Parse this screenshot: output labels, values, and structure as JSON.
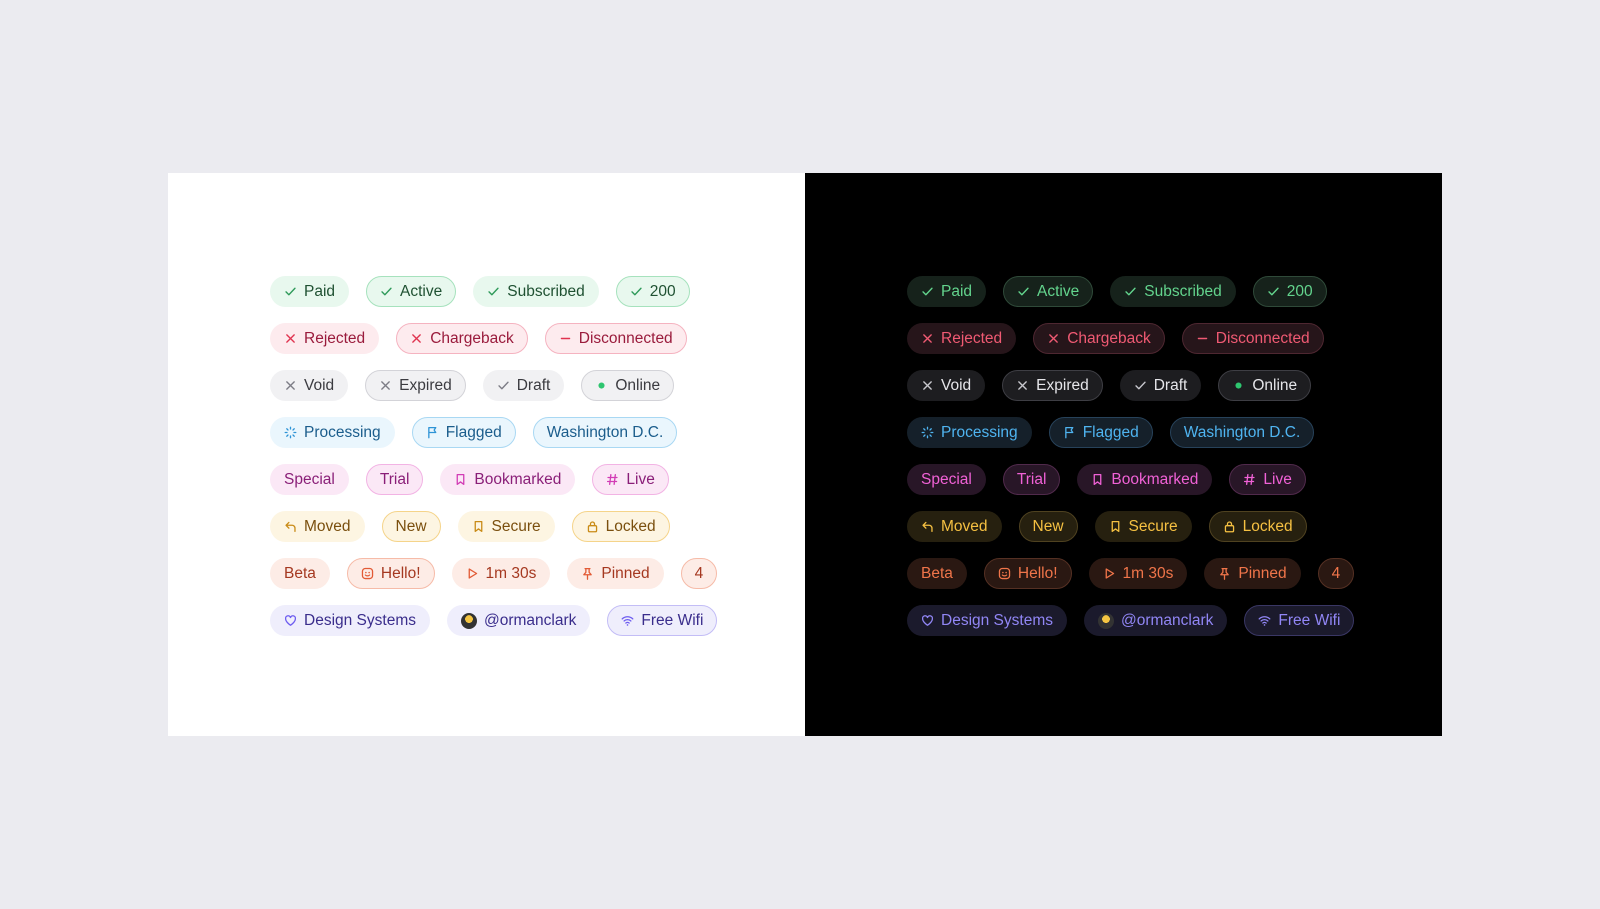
{
  "rows": [
    [
      {
        "label": "Paid",
        "icon": "check-icon",
        "palette": "green",
        "outline": false
      },
      {
        "label": "Active",
        "icon": "check-icon",
        "palette": "green",
        "outline": true
      },
      {
        "label": "Subscribed",
        "icon": "check-icon",
        "palette": "green",
        "outline": false
      },
      {
        "label": "200",
        "icon": "check-icon",
        "palette": "green",
        "outline": true
      }
    ],
    [
      {
        "label": "Rejected",
        "icon": "x-icon",
        "palette": "red",
        "outline": false
      },
      {
        "label": "Chargeback",
        "icon": "x-icon",
        "palette": "red",
        "outline": true
      },
      {
        "label": "Disconnected",
        "icon": "minus-icon",
        "palette": "red",
        "outline": true
      }
    ],
    [
      {
        "label": "Void",
        "icon": "x-icon",
        "palette": "gray",
        "outline": false
      },
      {
        "label": "Expired",
        "icon": "x-icon",
        "palette": "gray",
        "outline": true
      },
      {
        "label": "Draft",
        "icon": "check-icon",
        "palette": "gray",
        "outline": false
      },
      {
        "label": "Online",
        "icon": "dot-icon",
        "palette": "gray",
        "outline": true
      }
    ],
    [
      {
        "label": "Processing",
        "icon": "spinner-icon",
        "palette": "blue",
        "outline": false
      },
      {
        "label": "Flagged",
        "icon": "flag-icon",
        "palette": "blue",
        "outline": true
      },
      {
        "label": "Washington D.C.",
        "icon": "",
        "palette": "blue",
        "outline": true
      }
    ],
    [
      {
        "label": "Special",
        "icon": "",
        "palette": "pink",
        "outline": false
      },
      {
        "label": "Trial",
        "icon": "",
        "palette": "pink",
        "outline": true
      },
      {
        "label": "Bookmarked",
        "icon": "bookmark-icon",
        "palette": "pink",
        "outline": false
      },
      {
        "label": "Live",
        "icon": "hash-icon",
        "palette": "pink",
        "outline": true
      }
    ],
    [
      {
        "label": "Moved",
        "icon": "return-arrow-icon",
        "palette": "yellow",
        "outline": false
      },
      {
        "label": "New",
        "icon": "",
        "palette": "yellow",
        "outline": true
      },
      {
        "label": "Secure",
        "icon": "bookmark-icon",
        "palette": "yellow",
        "outline": false
      },
      {
        "label": "Locked",
        "icon": "lock-icon",
        "palette": "yellow",
        "outline": true
      }
    ],
    [
      {
        "label": "Beta",
        "icon": "",
        "palette": "orange",
        "outline": false
      },
      {
        "label": "Hello!",
        "icon": "smiley-icon",
        "palette": "orange",
        "outline": true
      },
      {
        "label": "1m 30s",
        "icon": "play-icon",
        "palette": "orange",
        "outline": false
      },
      {
        "label": "Pinned",
        "icon": "pin-icon",
        "palette": "orange",
        "outline": false
      },
      {
        "label": "4",
        "icon": "",
        "palette": "orange",
        "outline": true
      }
    ],
    [
      {
        "label": "Design Systems",
        "icon": "heart-icon",
        "palette": "purple",
        "outline": false
      },
      {
        "label": "@ormanclark",
        "icon": "avatar",
        "palette": "purple",
        "outline": false
      },
      {
        "label": "Free Wifi",
        "icon": "wifi-icon",
        "palette": "purple",
        "outline": true
      }
    ]
  ],
  "themes": {
    "light": {
      "green": {
        "bg": "#e8f8ee",
        "text": "#1f5132",
        "icon": "#2f9a5a",
        "border": "#a6e2bd"
      },
      "red": {
        "bg": "#fdebee",
        "text": "#9a1b3c",
        "icon": "#e0334f",
        "border": "#f5b3c0"
      },
      "gray": {
        "bg": "#f1f1f3",
        "text": "#3b3b40",
        "icon": "#7c7c85",
        "border": "#d3d3d8",
        "dot": "#2ec56f"
      },
      "blue": {
        "bg": "#eaf6fd",
        "text": "#1b5d8c",
        "icon": "#2d93d6",
        "border": "#a9d8f3"
      },
      "pink": {
        "bg": "#fbe8f6",
        "text": "#8a1f78",
        "icon": "#d23cb5",
        "border": "#f2b3e4"
      },
      "yellow": {
        "bg": "#fdf5e2",
        "text": "#7a4f0e",
        "icon": "#c98b17",
        "border": "#f5d48a"
      },
      "orange": {
        "bg": "#fdece6",
        "text": "#a53820",
        "icon": "#e25a35",
        "border": "#f6bba8"
      },
      "purple": {
        "bg": "#efeefc",
        "text": "#3a2d8c",
        "icon": "#6d5cf0",
        "border": "#c3bdf6"
      }
    },
    "dark": {
      "green": {
        "bg": "#16221b",
        "text": "#63d48d",
        "icon": "#63d48d",
        "border": "#2f4a39"
      },
      "red": {
        "bg": "#26151a",
        "text": "#f05a73",
        "icon": "#f05a73",
        "border": "#4e2731"
      },
      "gray": {
        "bg": "#1d1d20",
        "text": "#e6e6ea",
        "icon": "#c8c8ce",
        "border": "#3e3e44",
        "dot": "#2ec56f"
      },
      "blue": {
        "bg": "#15202a",
        "text": "#4fb4f0",
        "icon": "#4fb4f0",
        "border": "#27425a"
      },
      "pink": {
        "bg": "#281627",
        "text": "#f061d6",
        "icon": "#f061d6",
        "border": "#512a4c"
      },
      "yellow": {
        "bg": "#26200f",
        "text": "#f5c042",
        "icon": "#f5c042",
        "border": "#4f4220"
      },
      "orange": {
        "bg": "#2a1812",
        "text": "#f0754a",
        "icon": "#f0754a",
        "border": "#553023"
      },
      "purple": {
        "bg": "#1b1a2c",
        "text": "#9186f5",
        "icon": "#9186f5",
        "border": "#3a3765"
      }
    }
  }
}
